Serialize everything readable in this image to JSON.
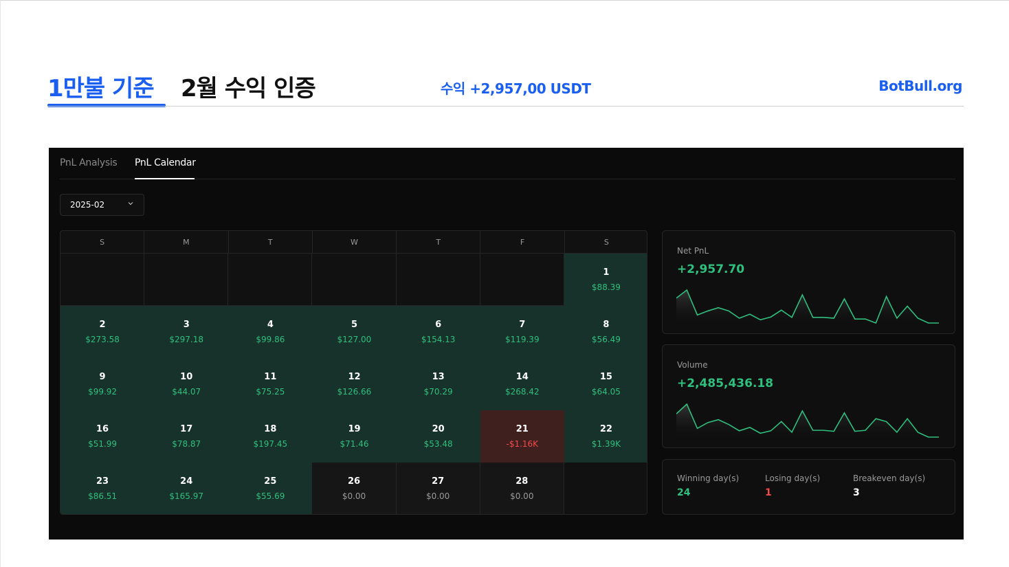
{
  "header": {
    "title_highlight": "1만불 기준",
    "title_main": "2월 수익 인증",
    "profit": "수익 +2,957,00 USDT",
    "site": "BotBull.org"
  },
  "tabs": [
    {
      "label": "PnL Analysis",
      "active": false
    },
    {
      "label": "PnL Calendar",
      "active": true
    }
  ],
  "month_select": {
    "value": "2025-02"
  },
  "calendar": {
    "weekdays": [
      "S",
      "M",
      "T",
      "W",
      "T",
      "F",
      "S"
    ],
    "leading_empty": 6,
    "days": [
      {
        "day": "1",
        "value": "$88.39",
        "status": "win"
      },
      {
        "day": "2",
        "value": "$273.58",
        "status": "win"
      },
      {
        "day": "3",
        "value": "$297.18",
        "status": "win"
      },
      {
        "day": "4",
        "value": "$99.86",
        "status": "win"
      },
      {
        "day": "5",
        "value": "$127.00",
        "status": "win"
      },
      {
        "day": "6",
        "value": "$154.13",
        "status": "win"
      },
      {
        "day": "7",
        "value": "$119.39",
        "status": "win"
      },
      {
        "day": "8",
        "value": "$56.49",
        "status": "win"
      },
      {
        "day": "9",
        "value": "$99.92",
        "status": "win"
      },
      {
        "day": "10",
        "value": "$44.07",
        "status": "win"
      },
      {
        "day": "11",
        "value": "$75.25",
        "status": "win"
      },
      {
        "day": "12",
        "value": "$126.66",
        "status": "win"
      },
      {
        "day": "13",
        "value": "$70.29",
        "status": "win"
      },
      {
        "day": "14",
        "value": "$268.42",
        "status": "win"
      },
      {
        "day": "15",
        "value": "$64.05",
        "status": "win"
      },
      {
        "day": "16",
        "value": "$51.99",
        "status": "win"
      },
      {
        "day": "17",
        "value": "$78.87",
        "status": "win"
      },
      {
        "day": "18",
        "value": "$197.45",
        "status": "win"
      },
      {
        "day": "19",
        "value": "$71.46",
        "status": "win"
      },
      {
        "day": "20",
        "value": "$53.48",
        "status": "win"
      },
      {
        "day": "21",
        "value": "-$1.16K",
        "status": "loss"
      },
      {
        "day": "22",
        "value": "$1.39K",
        "status": "win"
      },
      {
        "day": "23",
        "value": "$86.51",
        "status": "win"
      },
      {
        "day": "24",
        "value": "$165.97",
        "status": "win"
      },
      {
        "day": "25",
        "value": "$55.69",
        "status": "win"
      },
      {
        "day": "26",
        "value": "$0.00",
        "status": "even"
      },
      {
        "day": "27",
        "value": "$0.00",
        "status": "even"
      },
      {
        "day": "28",
        "value": "$0.00",
        "status": "even"
      }
    ]
  },
  "net_pnl": {
    "title": "Net PnL",
    "value": "+2,957.70",
    "trend": [
      0.62,
      0.82,
      0.2,
      0.3,
      0.38,
      0.3,
      0.12,
      0.22,
      0.08,
      0.15,
      0.32,
      0.14,
      0.7,
      0.14,
      0.14,
      0.12,
      0.6,
      0.1,
      0.1,
      0.0,
      0.66,
      0.12,
      0.42,
      0.12,
      0.0,
      0.0
    ]
  },
  "volume": {
    "title": "Volume",
    "value": "+2,485,436.18",
    "trend": [
      0.4,
      0.6,
      0.1,
      0.22,
      0.28,
      0.18,
      0.05,
      0.12,
      0.0,
      0.05,
      0.24,
      0.02,
      0.46,
      0.06,
      0.06,
      0.04,
      0.42,
      0.04,
      0.06,
      0.3,
      0.24,
      0.02,
      0.3,
      0.02,
      -0.08,
      -0.08
    ]
  },
  "summary": {
    "winning": {
      "label": "Winning day(s)",
      "value": "24"
    },
    "losing": {
      "label": "Losing day(s)",
      "value": "1"
    },
    "breakeven": {
      "label": "Breakeven day(s)",
      "value": "3"
    }
  },
  "colors": {
    "brand": "#1a5ff0",
    "positive": "#2fbf7f",
    "negative": "#f04a4a",
    "win_bg": "#17322a",
    "loss_bg": "#40201f"
  }
}
